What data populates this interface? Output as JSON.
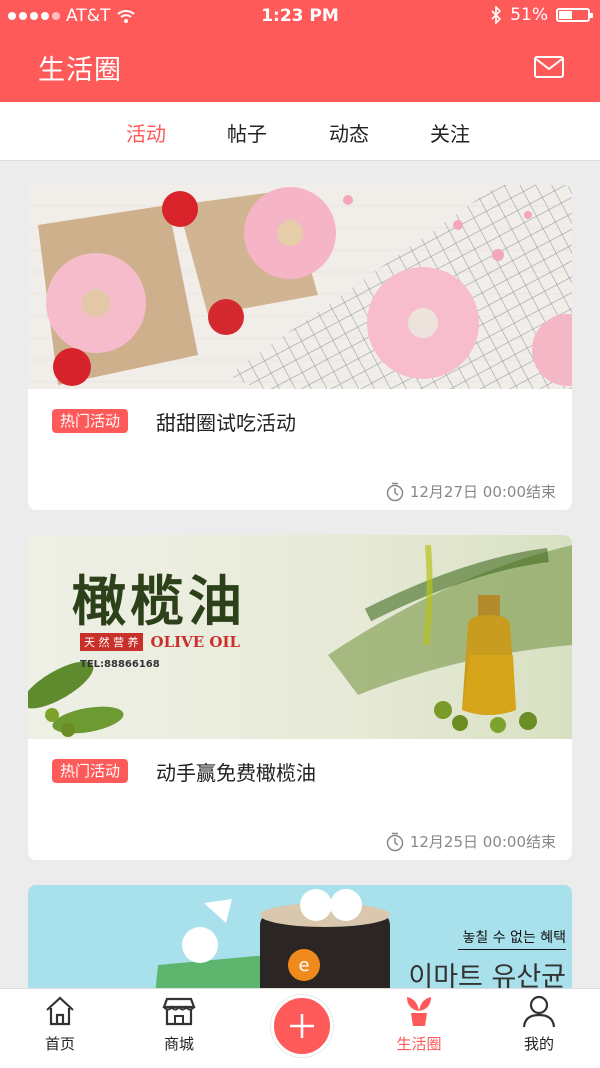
{
  "status_bar": {
    "carrier": "AT&T",
    "time": "1:23 PM",
    "battery": "51%",
    "battery_level": 0.51
  },
  "header": {
    "title": "生活圈",
    "mail_icon": "mail-icon"
  },
  "tabs": [
    {
      "label": "活动",
      "active": true
    },
    {
      "label": "帖子",
      "active": false
    },
    {
      "label": "动态",
      "active": false
    },
    {
      "label": "关注",
      "active": false
    }
  ],
  "cards": [
    {
      "badge": "热门活动",
      "title": "甜甜圈试吃活动",
      "end_time": "12月27日 00:00结束"
    },
    {
      "badge": "热门活动",
      "title": "动手赢免费橄榄油",
      "end_time": "12月25日 00:00结束",
      "banner": {
        "heading": "橄榄油",
        "tagline": "天 然 营 养",
        "english": "OLIVE OIL",
        "phone": "TEL:88866168"
      }
    },
    {
      "banner": {
        "korean_top": "놓칠 수 없는 혜택",
        "korean_main": "이마트 유산균"
      }
    }
  ],
  "tabbar": [
    {
      "label": "首页",
      "icon": "home-icon"
    },
    {
      "label": "商城",
      "icon": "store-icon"
    },
    {
      "label": "",
      "icon": "plus-icon"
    },
    {
      "label": "生活圈",
      "icon": "sprout-icon",
      "active": true
    },
    {
      "label": "我的",
      "icon": "user-icon"
    }
  ],
  "colors": {
    "accent": "#ff5a5a",
    "background": "#ececec"
  }
}
